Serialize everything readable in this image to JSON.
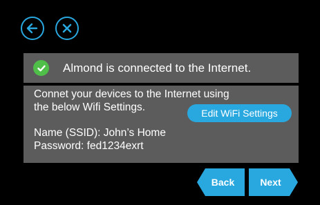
{
  "header": {
    "back_icon": "arrow-left-icon",
    "close_icon": "close-x-icon"
  },
  "status": {
    "icon": "check-circle-icon",
    "text": "Almond is connected to the Internet."
  },
  "info": {
    "line1": "Connet your devices to the Internet using",
    "line2": "the below Wifi Settings.",
    "ssid": "Name (SSID): John’s Home",
    "password": "Password: fed1234exrt",
    "edit_button_label": "Edit WiFi Settings"
  },
  "nav": {
    "back_label": "Back",
    "next_label": "Next"
  },
  "colors": {
    "accent": "#29a8e0",
    "panel": "#5c5c5c",
    "success": "#4fbf4a",
    "background": "#000000"
  }
}
